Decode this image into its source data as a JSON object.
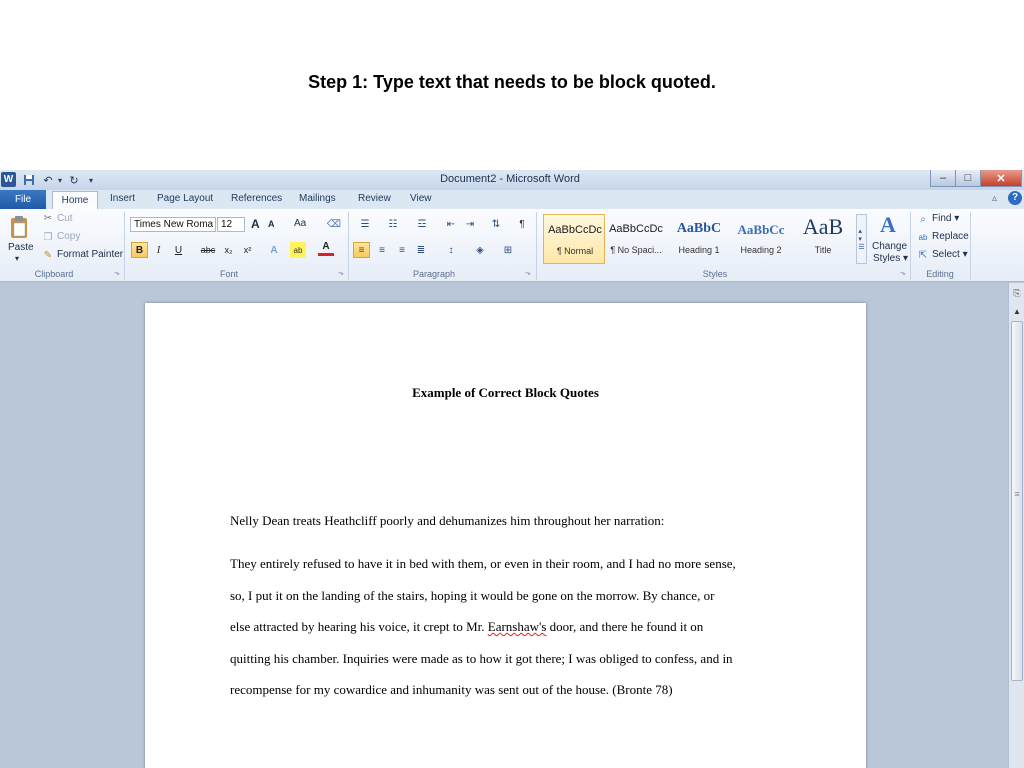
{
  "slide": {
    "title": "Step 1: Type text that needs to be block quoted."
  },
  "window": {
    "title": "Document2 - Microsoft Word",
    "app_icon": "W",
    "qat_icons": [
      "save-icon",
      "undo-icon",
      "redo-icon",
      "customize-icon"
    ],
    "controls": {
      "minimize": "–",
      "maximize": "□",
      "close": "✕"
    }
  },
  "ribbon_tabs": [
    "File",
    "Home",
    "Insert",
    "Page Layout",
    "References",
    "Mailings",
    "Review",
    "View"
  ],
  "ribbon": {
    "clipboard": {
      "label": "Clipboard",
      "paste": "Paste",
      "cut": "Cut",
      "copy": "Copy",
      "format_painter": "Format Painter"
    },
    "font": {
      "label": "Font",
      "font_name": "Times New Roma",
      "font_size": "12",
      "bold": "B",
      "italic": "I",
      "underline": "U",
      "strike": "abc",
      "subscript": "x₂",
      "superscript": "x²",
      "grow": "A",
      "shrink": "A",
      "change_case": "Aa"
    },
    "paragraph": {
      "label": "Paragraph"
    },
    "styles": {
      "label": "Styles",
      "items": [
        {
          "sample": "AaBbCcDc",
          "name": "¶ Normal"
        },
        {
          "sample": "AaBbCcDc",
          "name": "¶ No Spaci..."
        },
        {
          "sample": "AaBbC",
          "name": "Heading 1"
        },
        {
          "sample": "AaBbCc",
          "name": "Heading 2"
        },
        {
          "sample": "AaB",
          "name": "Title"
        }
      ],
      "change_styles": [
        "Change",
        "Styles ▾"
      ]
    },
    "editing": {
      "label": "Editing",
      "find": "Find ▾",
      "replace": "Replace",
      "select": "Select ▾"
    }
  },
  "document": {
    "heading": "Example of Correct Block Quotes",
    "intro": "Nelly Dean treats Heathcliff poorly and dehumanizes him throughout her narration:",
    "quote_lines": [
      "They entirely refused to have it in bed with them, or even in their room, and I had no more sense,",
      "so, I put it on the landing of the stairs, hoping it would be gone on the morrow. By chance, or",
      "door, and there he found it on",
      "quitting his chamber. Inquiries were made as to how it got there; I was obliged to confess, and in",
      "recompense for my cowardice and inhumanity was sent out of the house. (Bronte 78)"
    ],
    "quote_line3_before": "else attracted by hearing his voice, it crept to Mr. ",
    "quote_line3_misspelled": "Earnshaw's"
  }
}
